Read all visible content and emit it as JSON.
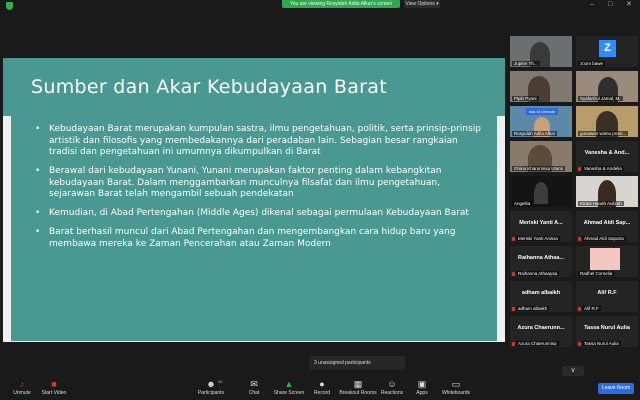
{
  "topbar": {
    "banner": "You are viewing Rosyidah Adila Afkar's screen",
    "view_options": "View Options",
    "view_options_caret": "▾",
    "win_min": "–",
    "win_max": "□",
    "win_close": "✕",
    "accent_color": "#2fa84f"
  },
  "slide": {
    "title": "Sumber dan Akar Kebudayaan Barat",
    "bullets": [
      "Kebudayaan Barat merupakan kumpulan sastra, ilmu pengetahuan, politik, serta prinsip-prinsip artistik dan filosofis yang membedakannya dari peradaban lain. Sebagian besar rangkaian tradisi dan pengetahuan ini umumnya dikumpulkan di Barat",
      "Berawal dari kebudayaan Yunani, Yunani merupakan faktor penting dalam kebangkitan kebudayaan Barat. Dalam menggambarkan munculnya filsafat dan ilmu pengetahuan, sejarawan Barat telah mengambil sebuah pendekatan",
      "Kemudian, di Abad Pertengahan (Middle Ages) dikenal sebagai permulaan Kebudayaan Barat",
      "Barat berhasil muncul dari Abad Pertengahan dan mengembangkan cara hidup baru yang membawa mereka ke Zaman Pencerahan atau Zaman Modern"
    ],
    "bg_color": "#4a9892"
  },
  "participants": [
    {
      "name": "Jupiter Th...",
      "center": "",
      "type": "video"
    },
    {
      "name": "zoom bawe",
      "center": "",
      "type": "avatar-z",
      "avatar_letter": "Z"
    },
    {
      "name": "Pipih Pyani",
      "center": "",
      "type": "video"
    },
    {
      "name": "Syafarizul Jamal, M.",
      "center": "",
      "type": "video"
    },
    {
      "name": "Rosyidah Adila Afkar",
      "center": "",
      "type": "video",
      "overlay": "Ask to Unmute"
    },
    {
      "name": "gunawan wisnu pram...",
      "center": "",
      "type": "video"
    },
    {
      "name": "Ghina Kharunnisa Utami",
      "center": "",
      "type": "video"
    },
    {
      "name": "Vanesha & Andelia",
      "center": "Vanesha & And...",
      "type": "name"
    },
    {
      "name": "Angelita",
      "center": "",
      "type": "video"
    },
    {
      "name": "Kirani Hanah Aulizah",
      "center": "",
      "type": "video"
    },
    {
      "name": "Meriski Yanti Anissa",
      "center": "Meriski Yanti A...",
      "type": "name"
    },
    {
      "name": "Ahmad Aldi Saputra",
      "center": "Ahmad Aldi Sap...",
      "type": "name"
    },
    {
      "name": "Raihanna Athaayaa",
      "center": "Raihanna Athaa...",
      "type": "name"
    },
    {
      "name": "Radhel Cornelia",
      "center": "",
      "type": "video"
    },
    {
      "name": "adham albaikh",
      "center": "adham albaikh",
      "type": "name"
    },
    {
      "name": "Alif R.F",
      "center": "Alif R.F",
      "type": "name"
    },
    {
      "name": "Azura Chaerunnisa",
      "center": "Azura Chaerunn...",
      "type": "name"
    },
    {
      "name": "Tassa Nurul Aulia",
      "center": "Tassa Nurul Aulia",
      "type": "name"
    }
  ],
  "scroll_more_glyph": "∨",
  "toast": {
    "text": "3 unassigned participants"
  },
  "toolbar": {
    "unmute": "Unmute",
    "start_video": "Start Video",
    "participants": "Participants",
    "participants_count": "55",
    "chat": "Chat",
    "share_screen": "Share Screen",
    "record": "Record",
    "breakout_rooms": "Breakout Rooms",
    "reactions": "Reactions",
    "apps": "Apps",
    "whiteboards": "Whiteboards",
    "leave": "Leave Room",
    "icons": {
      "unmute": "♪",
      "start_video": "■",
      "participants": "☻",
      "chat": "✉",
      "share_screen": "▲",
      "record": "●",
      "breakout_rooms": "▦",
      "reactions": "☺",
      "apps": "▣",
      "whiteboards": "▭"
    }
  }
}
